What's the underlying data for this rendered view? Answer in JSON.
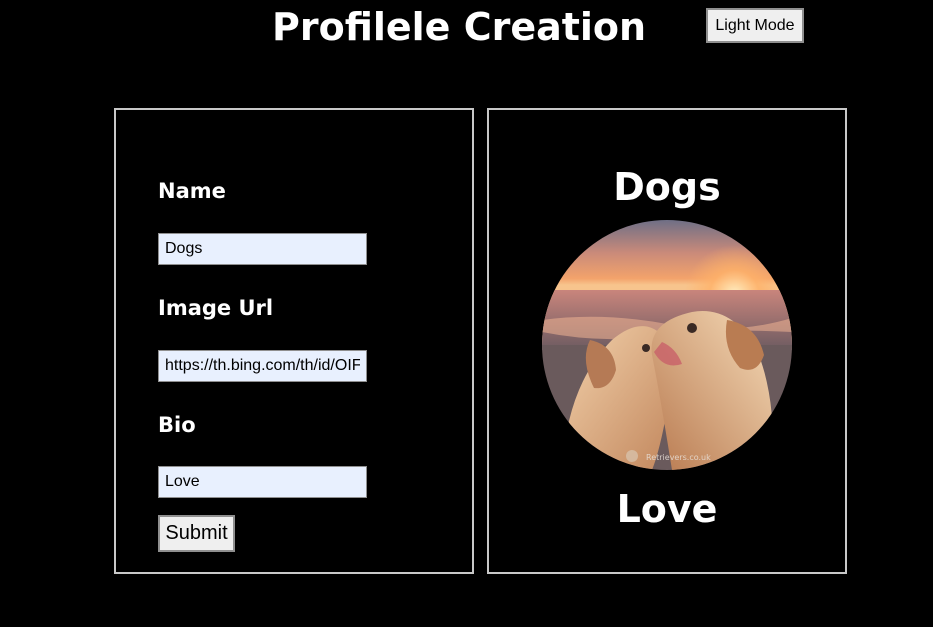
{
  "header": {
    "title": "Profilele Creation",
    "mode_button_label": "Light Mode"
  },
  "form": {
    "name_label": "Name",
    "name_value": "Dogs",
    "image_url_label": "Image Url",
    "image_url_value": "https://th.bing.com/th/id/OIF",
    "bio_label": "Bio",
    "bio_value": "Love",
    "submit_label": "Submit"
  },
  "preview": {
    "name": "Dogs",
    "bio": "Love",
    "image_icon": "photo-of-two-puppies-on-beach-at-sunset",
    "image_watermark": "Retrievers.co.uk"
  },
  "colors": {
    "background": "#000000",
    "text": "#ffffff",
    "panel_border": "#c8c8c8",
    "input_background": "#e8f0fe"
  }
}
